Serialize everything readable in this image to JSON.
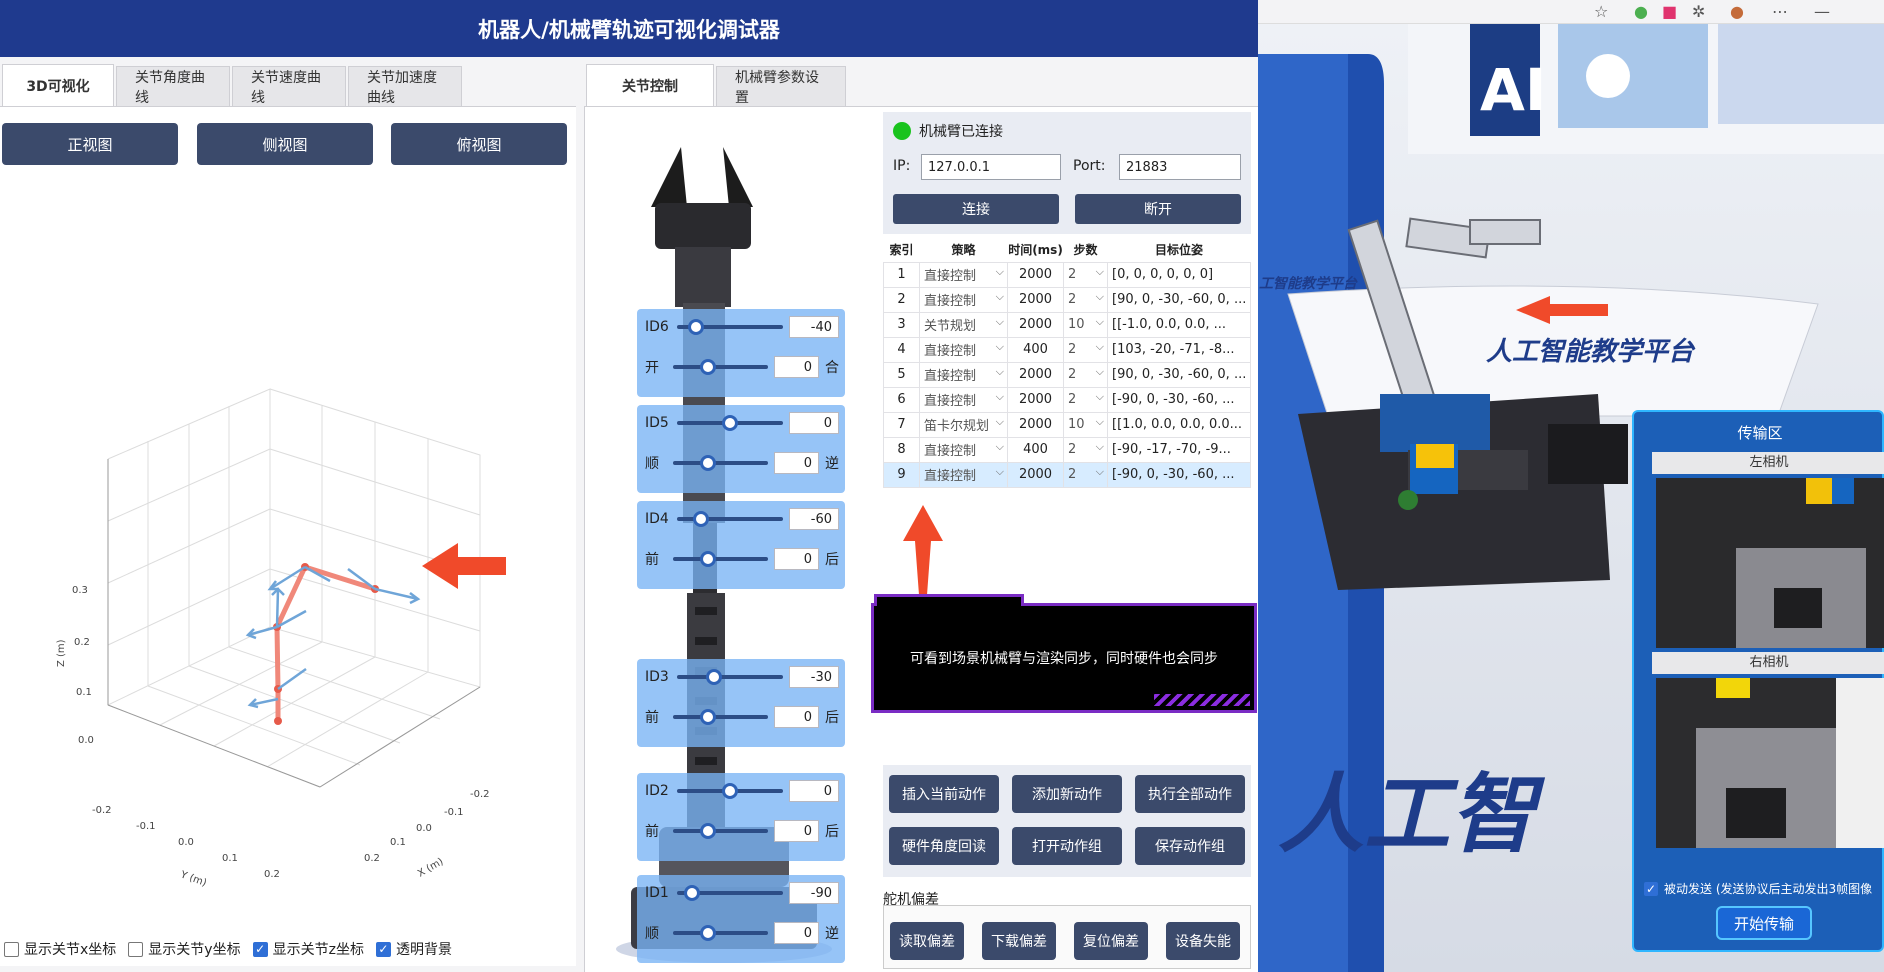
{
  "app": {
    "title": "机器人/机械臂轨迹可视化调试器"
  },
  "left_panel": {
    "tabs": [
      "3D可视化",
      "关节角度曲线",
      "关节速度曲线",
      "关节加速度曲线"
    ],
    "view_buttons": [
      "正视图",
      "侧视图",
      "俯视图"
    ],
    "plot": {
      "z_label": "Z (m)",
      "y_label": "Y (m)",
      "x_label": "X (m)",
      "z_ticks": [
        "0.3",
        "0.2",
        "0.1",
        "0.0"
      ],
      "y_ticks": [
        "-0.2",
        "-0.1",
        "0.0",
        "0.1",
        "0.2"
      ],
      "x_ticks": [
        "-0.2",
        "-0.1",
        "0.0",
        "0.1",
        "0.2"
      ]
    },
    "checkboxes": [
      {
        "label": "显示关节x坐标",
        "checked": false
      },
      {
        "label": "显示关节y坐标",
        "checked": false
      },
      {
        "label": "显示关节z坐标",
        "checked": true
      },
      {
        "label": "透明背景",
        "checked": true
      }
    ]
  },
  "right_panel": {
    "tabs": [
      "关节控制",
      "机械臂参数设置"
    ],
    "joints": [
      {
        "id": "ID6",
        "value": "-40",
        "sub_left": "开",
        "sub_value": "0",
        "sub_right": "合",
        "level": 0.12,
        "sub_level": 0.3
      },
      {
        "id": "ID5",
        "value": "0",
        "sub_left": "顺",
        "sub_value": "0",
        "sub_right": "逆",
        "level": 0.5,
        "sub_level": 0.3
      },
      {
        "id": "ID4",
        "value": "-60",
        "sub_left": "前",
        "sub_value": "0",
        "sub_right": "后",
        "level": 0.18,
        "sub_level": 0.3
      },
      {
        "id": "ID3",
        "value": "-30",
        "sub_left": "前",
        "sub_value": "0",
        "sub_right": "后",
        "level": 0.32,
        "sub_level": 0.3
      },
      {
        "id": "ID2",
        "value": "0",
        "sub_left": "前",
        "sub_value": "0",
        "sub_right": "后",
        "level": 0.5,
        "sub_level": 0.3
      },
      {
        "id": "ID1",
        "value": "-90",
        "sub_left": "顺",
        "sub_value": "0",
        "sub_right": "逆",
        "level": 0.08,
        "sub_level": 0.3
      }
    ],
    "connection": {
      "status": "机械臂已连接",
      "ip_label": "IP:",
      "ip": "127.0.0.1",
      "port_label": "Port:",
      "port": "21883",
      "connect": "连接",
      "disconnect": "断开"
    },
    "table": {
      "headers": [
        "索引",
        "策略",
        "时间(ms)",
        "步数",
        "目标位姿"
      ],
      "rows": [
        [
          "1",
          "直接控制",
          "2000",
          "2",
          "[0, 0, 0, 0, 0, 0]"
        ],
        [
          "2",
          "直接控制",
          "2000",
          "2",
          "[90, 0, -30, -60, 0, ..."
        ],
        [
          "3",
          "关节规划",
          "2000",
          "10",
          "[[-1.0, 0.0, 0.0, ..."
        ],
        [
          "4",
          "直接控制",
          "400",
          "2",
          "[103, -20, -71, -8..."
        ],
        [
          "5",
          "直接控制",
          "2000",
          "2",
          "[90, 0, -30, -60, 0, ..."
        ],
        [
          "6",
          "直接控制",
          "2000",
          "2",
          "[-90, 0, -30, -60, ..."
        ],
        [
          "7",
          "笛卡尔规划",
          "2000",
          "10",
          "[[1.0, 0.0, 0.0, 0.0..."
        ],
        [
          "8",
          "直接控制",
          "400",
          "2",
          "[-90, -17, -70, -9..."
        ],
        [
          "9",
          "直接控制",
          "2000",
          "2",
          "[-90, 0, -30, -60, ..."
        ]
      ]
    },
    "annotation": "可看到场景机械臂与渲染同步，同时硬件也会同步",
    "action_buttons": [
      "插入当前动作",
      "添加新动作",
      "执行全部动作",
      "硬件角度回读",
      "打开动作组",
      "保存动作组"
    ],
    "offset_title": "舵机偏差",
    "offset_buttons": [
      "读取偏差",
      "下载偏差",
      "复位偏差",
      "设备失能"
    ]
  },
  "scene": {
    "sign_top": "AI",
    "platform_small": "工智能教学平台",
    "platform_big": "人工智能教学平台",
    "banner": "人工智",
    "transfer": {
      "title": "传输区",
      "left_cam": "左相机",
      "right_cam": "右相机",
      "auto_send": "被动发送 (发送协议后主动发出3帧图像",
      "start": "开始传输"
    }
  },
  "colors": {
    "title_bar": "#1f3a8e",
    "button": "#3b4a6b",
    "link_ok": "#19c31d",
    "joint_panel": "#78b4f5",
    "arrow": "#f04a2a",
    "note_border": "#7a2cc4"
  }
}
